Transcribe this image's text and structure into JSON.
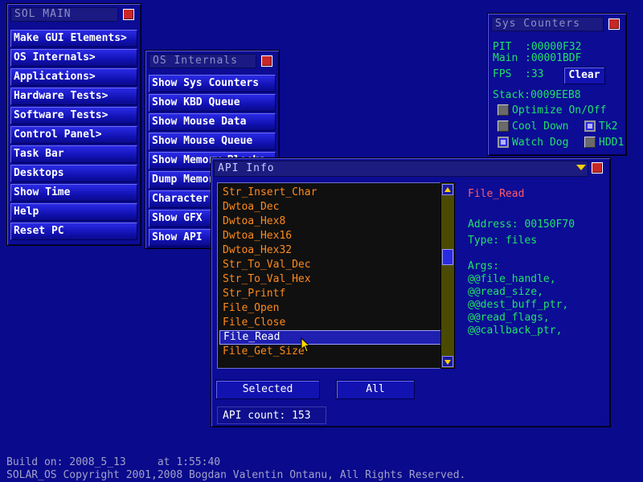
{
  "sol_main": {
    "title": "SOL MAIN",
    "items": [
      {
        "label": "Make GUI Elements>"
      },
      {
        "label": "OS Internals>"
      },
      {
        "label": "Applications>"
      },
      {
        "label": "Hardware Tests>"
      },
      {
        "label": "Software Tests>"
      },
      {
        "label": "Control Panel>"
      },
      {
        "label": "Task Bar"
      },
      {
        "label": "Desktops"
      },
      {
        "label": "Show Time"
      },
      {
        "label": "Help"
      },
      {
        "label": "Reset PC"
      }
    ]
  },
  "os_internals": {
    "title": "OS Internals",
    "items": [
      {
        "label": "Show Sys Counters"
      },
      {
        "label": "Show KBD Queue"
      },
      {
        "label": "Show Mouse Data"
      },
      {
        "label": "Show Mouse Queue"
      },
      {
        "label": "Show Memory Blocks"
      },
      {
        "label": "Dump Memory"
      },
      {
        "label": "Character Set"
      },
      {
        "label": "Show GFX"
      },
      {
        "label": "Show API"
      }
    ]
  },
  "sys_counters": {
    "title": "Sys Counters",
    "pit_label": "PIT",
    "pit_value": ":00000F32",
    "main_label": "Main",
    "main_value": ":00001BDF",
    "fps_label": "FPS",
    "fps_value": ":33",
    "clear_label": "Clear",
    "stack_label": "Stack:0009EEB8",
    "options": [
      {
        "label": "Optimize On/Off",
        "checked": false
      },
      {
        "label": "Cool Down",
        "checked": false
      },
      {
        "label": "Tk2",
        "checked": true
      },
      {
        "label": "Watch Dog",
        "checked": true
      },
      {
        "label": "HDD1",
        "checked": false
      }
    ]
  },
  "api_info": {
    "title": "API Info",
    "list": [
      "Str_Insert_Char",
      "Dwtoa_Dec",
      "Dwtoa_Hex8",
      "Dwtoa_Hex16",
      "Dwtoa_Hex32",
      "Str_To_Val_Dec",
      "Str_To_Val_Hex",
      "Str_Printf",
      "File_Open",
      "File_Close",
      "File_Read",
      "File_Get_Size"
    ],
    "selected_index": 10,
    "detail": {
      "name": "File_Read",
      "address": "Address: 00150F70",
      "type": "Type: files",
      "args_label": "Args:",
      "args": [
        "@@file_handle,",
        "@@read_size,",
        "@@dest_buff_ptr,",
        "@@read_flags,",
        "@@callback_ptr,"
      ]
    },
    "selected_btn": "Selected",
    "all_btn": "All",
    "api_count": "API count: 153"
  },
  "footer": {
    "build": "Build on: 2008_5_13     at 1:55:40",
    "copyright": "SOLAR_OS Copyright 2001,2008 Bogdan Valentin Ontanu, All Rights Reserved."
  },
  "colors": {
    "desktop": "#0a0a8c",
    "list_text": "#ff8a1c",
    "info_name": "#ff5a6a",
    "info_text": "#22e06a",
    "counters_text": "#22e06a"
  }
}
